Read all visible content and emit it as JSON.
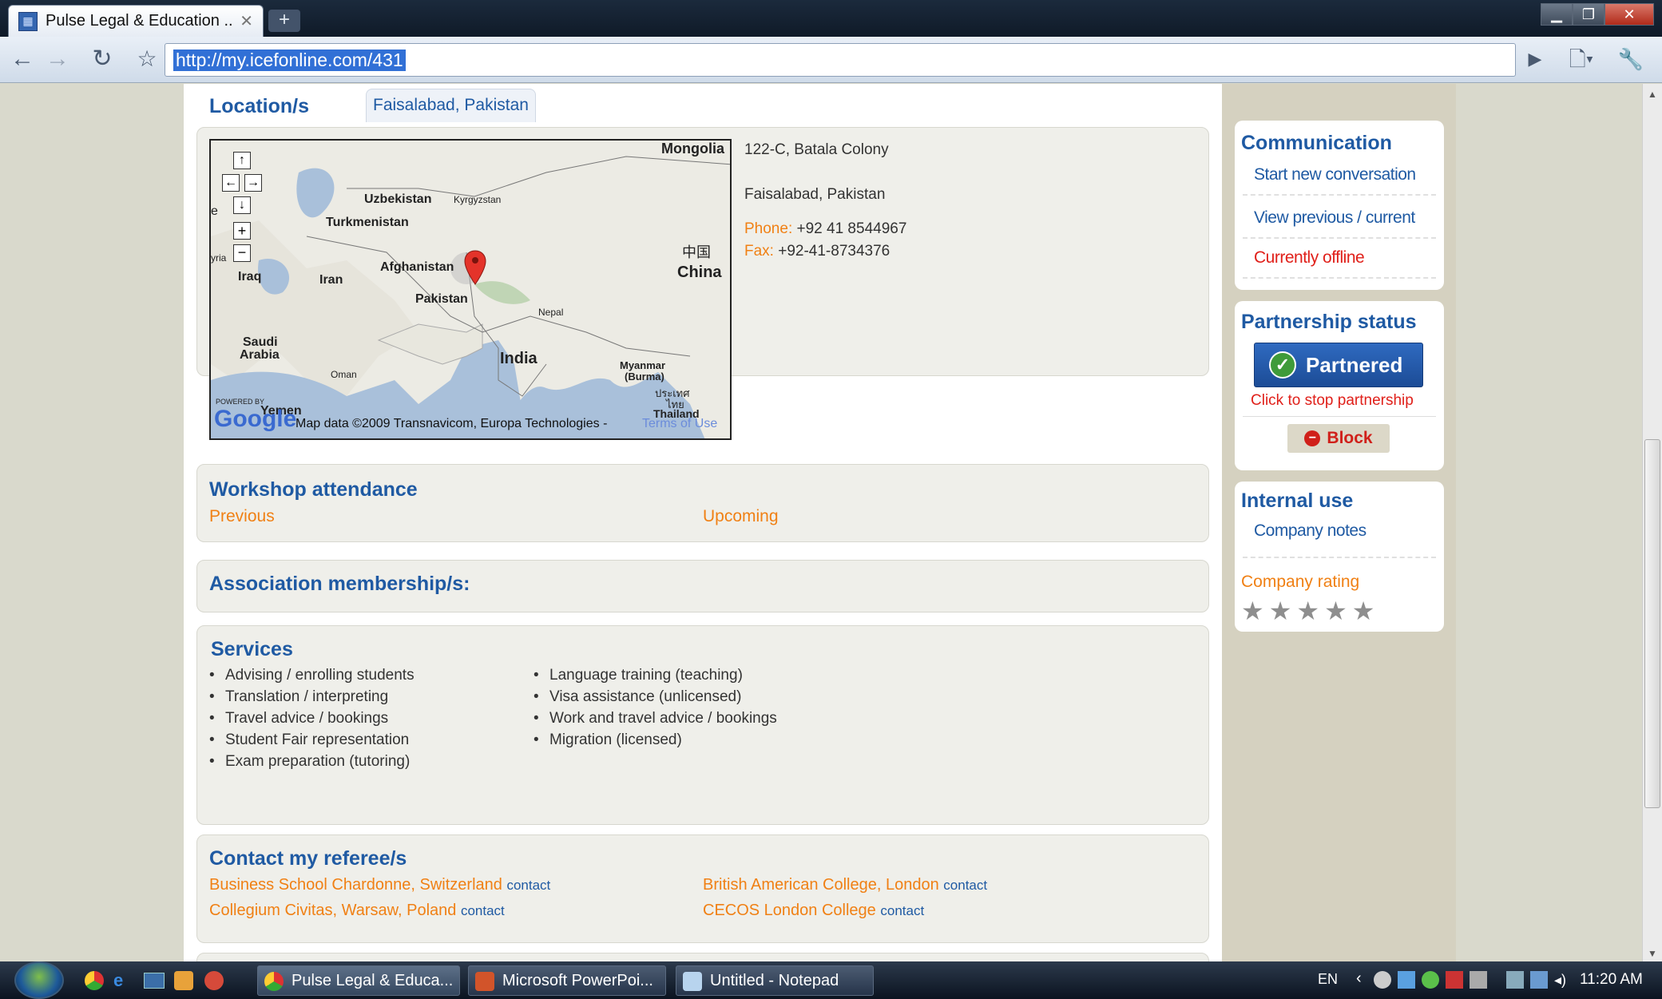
{
  "browser": {
    "tab_title": "Pulse Legal & Education ...",
    "url": "http://my.icefonline.com/431"
  },
  "location": {
    "heading": "Location/s",
    "tab": "Faisalabad, Pakistan",
    "address_line1": "122-C, Batala Colony",
    "address_line2": "Faisalabad, Pakistan",
    "phone_label": "Phone:",
    "phone": "+92 41 8544967",
    "fax_label": "Fax:",
    "fax": "+92-41-8734376",
    "map": {
      "labels": {
        "mongolia": "Mongolia",
        "uzbekistan": "Uzbekistan",
        "kyrgyzstan": "Kyrgyzstan",
        "turkmenistan": "Turkmenistan",
        "china_zh": "中国",
        "china": "China",
        "afghanistan": "Afghanistan",
        "iraq": "Iraq",
        "iran": "Iran",
        "pakistan": "Pakistan",
        "nepal": "Nepal",
        "saudi": "Saudi",
        "arabia": "Arabia",
        "india": "India",
        "oman": "Oman",
        "myanmar": "Myanmar",
        "burma": "(Burma)",
        "thailand_th": "ประเทศ",
        "thailand_th2": "ไทย",
        "thailand": "Thailand",
        "yemen": "Yemen",
        "powered_by": "POWERED BY",
        "google": "Google",
        "attribution": "Map data ©2009 Transnavicom, Europa Technologies -",
        "terms": "Terms of Use",
        "edge_e": "e",
        "edge_yria": "yria"
      }
    }
  },
  "workshop": {
    "heading": "Workshop attendance",
    "previous": "Previous",
    "upcoming": "Upcoming"
  },
  "association": {
    "heading": "Association membership/s:"
  },
  "services": {
    "heading": "Services",
    "col1": [
      "Advising / enrolling students",
      "Translation / interpreting",
      "Travel advice / bookings",
      "Student Fair representation",
      "Exam preparation (tutoring)"
    ],
    "col2": [
      "Language training (teaching)",
      "Visa assistance (unlicensed)",
      "Work and travel advice / bookings",
      "Migration (licensed)"
    ]
  },
  "referees": {
    "heading": "Contact my referee/s",
    "contact_label": "contact",
    "items": [
      "Business School Chardonne, Switzerland",
      "British American College, London",
      "Collegium Civitas, Warsaw, Poland",
      "CECOS London College"
    ]
  },
  "sidebar": {
    "communication": {
      "heading": "Communication",
      "start": "Start new conversation",
      "view": "View previous / current",
      "status": "Currently offline"
    },
    "partnership": {
      "heading": "Partnership status",
      "button": "Partnered",
      "stop": "Click to stop partnership",
      "block": "Block"
    },
    "internal": {
      "heading": "Internal use",
      "notes": "Company notes",
      "rating_label": "Company rating",
      "rating_stars_filled": 0,
      "rating_stars_total": 5
    }
  },
  "taskbar": {
    "items": [
      "Pulse Legal & Educa...",
      "Microsoft PowerPoi...",
      "Untitled - Notepad"
    ],
    "lang": "EN",
    "time": "11:20 AM"
  },
  "colors": {
    "heading_blue": "#1f5aa3",
    "link_orange": "#f08014",
    "offline_red": "#e0201a",
    "partner_blue": "#1f56a8"
  }
}
